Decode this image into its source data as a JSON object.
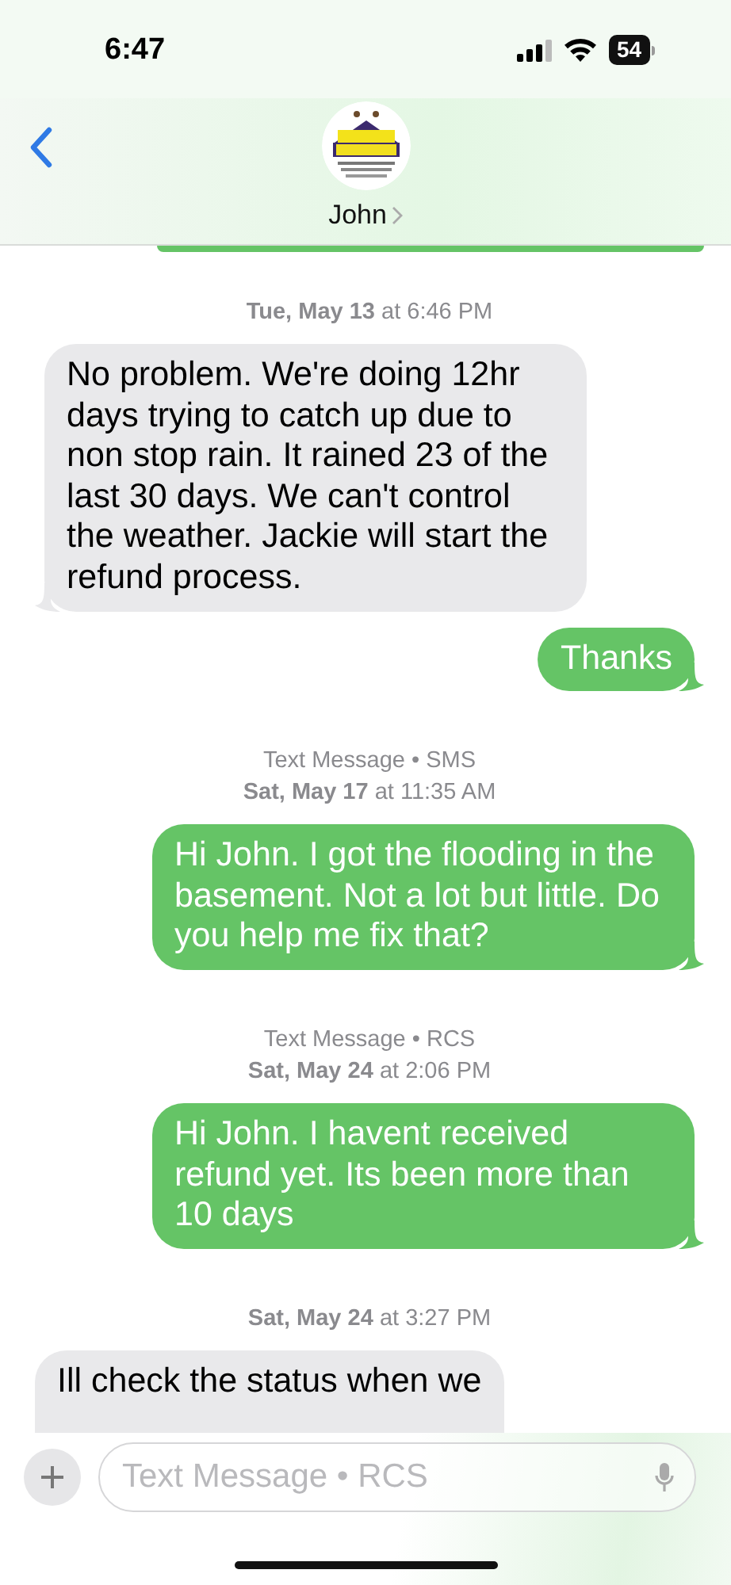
{
  "status_bar": {
    "time": "6:47",
    "battery": "54"
  },
  "header": {
    "contact": "John"
  },
  "messages": [
    {
      "kind": "outgoing"
    },
    {
      "kind": "stamp",
      "date": "**Tue, May 13** at 6:46 PM"
    },
    {
      "kind": "incoming",
      "text": "No problem. We're doing 12hr days trying to catch up due to non stop rain. It rained 23 of the last 30 days. We can't control the weather. Jackie will start the refund process.",
      "tail": true
    },
    {
      "kind": "outgoing",
      "text": "Thanks",
      "tail": true
    },
    {
      "kind": "stamp",
      "service": "Text Message • SMS",
      "date": "**Sat, May 17** at 11:35 AM"
    },
    {
      "kind": "outgoing",
      "text": "Hi John. I got the flooding in the basement. Not a lot but little. Do you help me fix that?",
      "tail": true
    },
    {
      "kind": "stamp",
      "service": "Text Message • RCS",
      "date": "**Sat, May 24** at 2:06 PM"
    },
    {
      "kind": "outgoing",
      "text": "Hi John. I havent received refund yet. Its been more than 10 days",
      "tail": true
    },
    {
      "kind": "stamp",
      "date": "**Sat, May 24** at 3:27 PM"
    },
    {
      "kind": "incoming",
      "text": "Ill check the status when we",
      "tail": false
    }
  ],
  "compose": {
    "placeholder": "Text Message • RCS"
  }
}
